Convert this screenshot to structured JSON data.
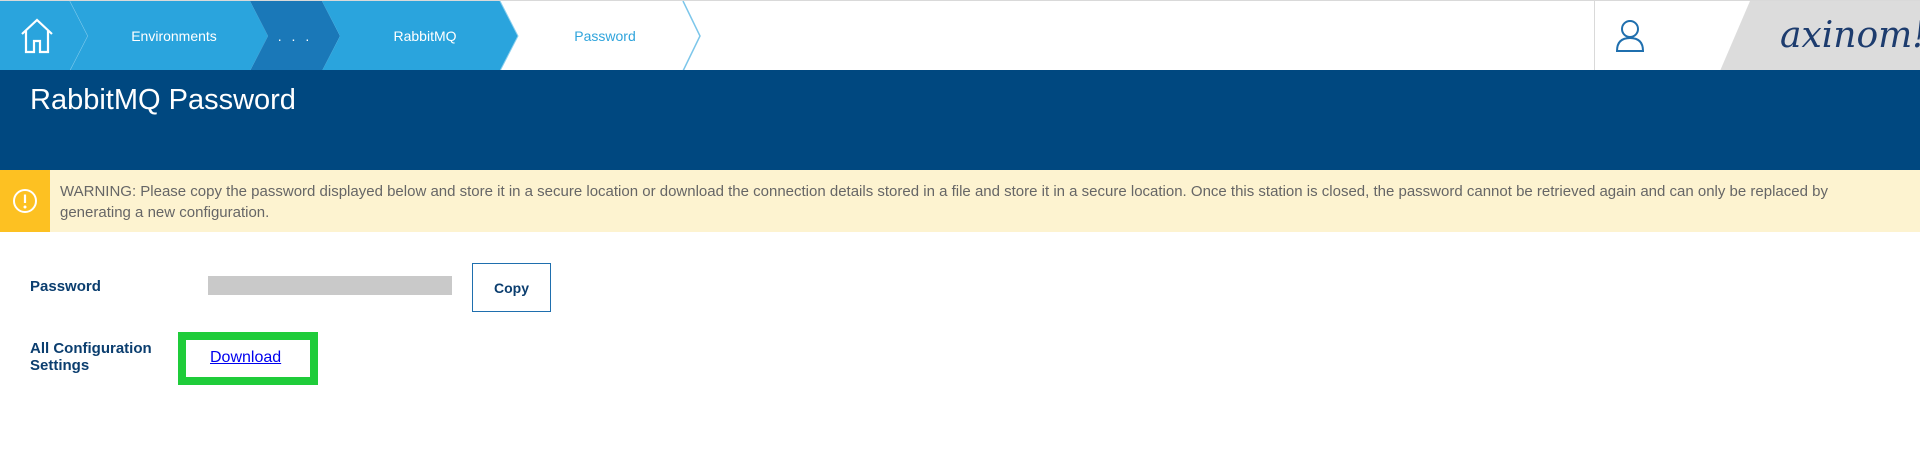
{
  "colors": {
    "breadcrumb_blue": "#29a3dc",
    "breadcrumb_dark": "#1a78b8",
    "title_band": "#004880",
    "warning_bg": "#fdf3d0",
    "warning_icon_bg": "#fdc122",
    "highlight_green": "#1fcc3a"
  },
  "breadcrumb": {
    "home_icon": "home-icon",
    "items": [
      {
        "label": "Environments"
      },
      {
        "label": ". . ."
      },
      {
        "label": "RabbitMQ"
      },
      {
        "label": "Password"
      }
    ]
  },
  "header": {
    "user_icon": "user-icon",
    "logo_text": "axinom!"
  },
  "page": {
    "title": "RabbitMQ Password"
  },
  "warning": {
    "icon": "warning-icon",
    "text": "WARNING: Please copy the password displayed below and store it in a secure location or download the connection details stored in a file and store it in a secure location. Once this station is closed, the password cannot be retrieved again and can only be replaced by generating a new configuration."
  },
  "form": {
    "password_label": "Password",
    "copy_label": "Copy",
    "config_label": "All Configuration Settings",
    "download_label": "Download"
  }
}
